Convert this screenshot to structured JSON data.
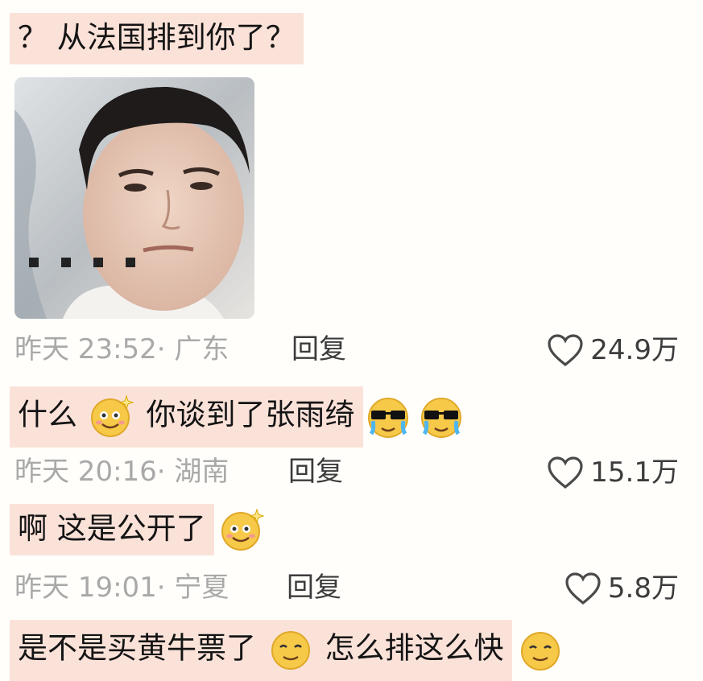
{
  "comments": [
    {
      "text": "？ 从法国排到你了？",
      "time": "昨天 23:52",
      "location": "广东",
      "reply_label": "回复",
      "likes": "24.9万"
    },
    {
      "text_a": "什么",
      "text_b": "你谈到了张雨绮",
      "time": "昨天 20:16",
      "location": "湖南",
      "reply_label": "回复",
      "likes": "15.1万"
    },
    {
      "text": "啊 这是公开了",
      "time": "昨天 19:01",
      "location": "宁夏",
      "reply_label": "回复",
      "likes": "5.8万"
    },
    {
      "text_a": "是不是买黄牛票了",
      "text_b": "怎么排这么快"
    }
  ],
  "colors": {
    "highlight": "#fbe2d9",
    "meta": "#a9a9a9",
    "text": "#141414"
  },
  "icons": [
    "heart-icon",
    "smile-sparkle-emoji",
    "crying-sunglasses-emoji",
    "awkward-smile-emoji"
  ]
}
